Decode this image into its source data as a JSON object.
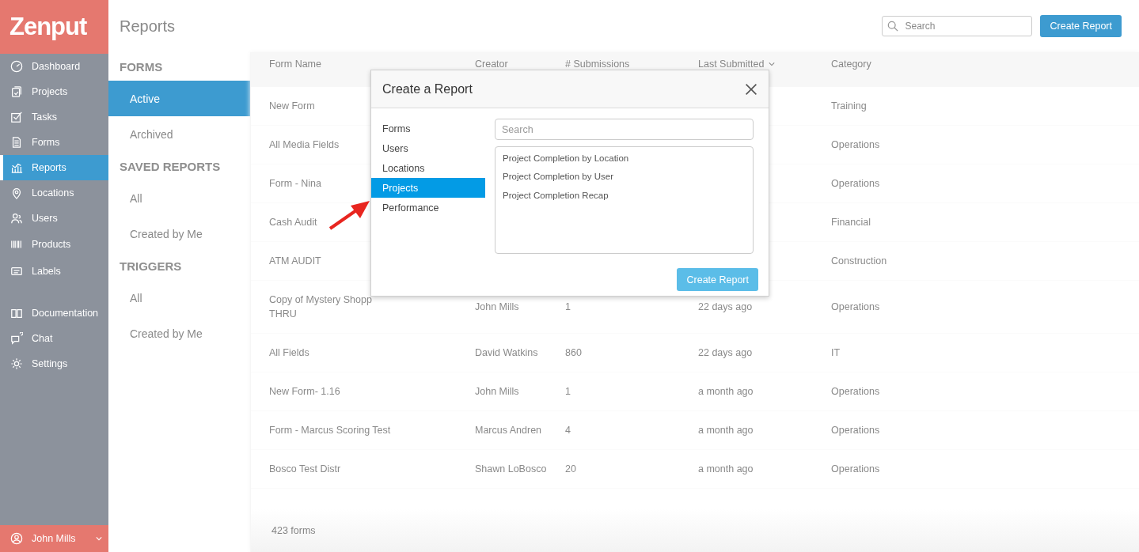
{
  "sidebar": {
    "logo": "Zenput",
    "items": [
      {
        "label": "Dashboard",
        "selected": false
      },
      {
        "label": "Projects",
        "selected": false
      },
      {
        "label": "Tasks",
        "selected": false
      },
      {
        "label": "Forms",
        "selected": false
      },
      {
        "label": "Reports",
        "selected": true
      },
      {
        "label": "Locations",
        "selected": false
      },
      {
        "label": "Users",
        "selected": false
      },
      {
        "label": "Products",
        "selected": false
      },
      {
        "label": "Labels",
        "selected": false
      }
    ],
    "help_items": [
      {
        "label": "Documentation"
      },
      {
        "label": "Chat"
      },
      {
        "label": "Settings"
      }
    ],
    "user": {
      "name": "John Mills"
    }
  },
  "header": {
    "title": "Reports",
    "search": {
      "placeholder": "Search"
    },
    "button": "Create Report"
  },
  "subnav": [
    {
      "heading": "FORMS",
      "items": [
        {
          "label": "Active",
          "selected": true
        },
        {
          "label": "Archived",
          "selected": false
        }
      ]
    },
    {
      "heading": "SAVED REPORTS",
      "items": [
        {
          "label": "All",
          "selected": false
        },
        {
          "label": "Created by Me",
          "selected": false
        }
      ]
    },
    {
      "heading": "TRIGGERS",
      "items": [
        {
          "label": "All",
          "selected": false
        },
        {
          "label": "Created by Me",
          "selected": false
        }
      ]
    }
  ],
  "table": {
    "columns": [
      {
        "label": "Form Name",
        "sorted": false
      },
      {
        "label": "Creator",
        "sorted": false
      },
      {
        "label": "# Submissions",
        "sorted": false
      },
      {
        "label": "Last Submitted",
        "sorted": true
      },
      {
        "label": "Category",
        "sorted": false
      }
    ],
    "rows": [
      {
        "name": [
          "New Form"
        ],
        "category": "Training"
      },
      {
        "name": [
          "All Media Fields"
        ],
        "category": "Operations"
      },
      {
        "name": [
          "Form - Nina"
        ],
        "category": "Operations"
      },
      {
        "name": [
          "Cash Audit"
        ],
        "category": "Financial"
      },
      {
        "name": [
          "ATM AUDIT"
        ],
        "category": "Construction"
      },
      {
        "name": [
          "Copy of Mystery Shopp",
          "THRU"
        ],
        "creator": "John Mills",
        "submissions": "1",
        "last_submitted": "22 days ago",
        "category": "Operations"
      },
      {
        "name": [
          "All Fields"
        ],
        "creator": "David Watkins",
        "submissions": "860",
        "last_submitted": "22 days ago",
        "category": "IT"
      },
      {
        "name": [
          "New Form- 1.16"
        ],
        "creator": "John Mills",
        "submissions": "1",
        "last_submitted": "a month ago",
        "category": "Operations"
      },
      {
        "name": [
          "Form - Marcus Scoring Test"
        ],
        "creator": "Marcus Andren",
        "submissions": "4",
        "last_submitted": "a month ago",
        "category": "Operations"
      },
      {
        "name": [
          "Bosco Test Distr"
        ],
        "creator": "Shawn LoBosco",
        "submissions": "20",
        "last_submitted": "a month ago",
        "category": "Operations"
      }
    ],
    "footer": "423 forms"
  },
  "modal": {
    "title": "Create a Report",
    "categories": [
      {
        "label": "Forms",
        "selected": false
      },
      {
        "label": "Users",
        "selected": false
      },
      {
        "label": "Locations",
        "selected": false
      },
      {
        "label": "Projects",
        "selected": true
      },
      {
        "label": "Performance",
        "selected": false
      }
    ],
    "search": {
      "placeholder": "Search"
    },
    "reports": [
      "Project Completion by Location",
      "Project Completion by User",
      "Project Completion Recap"
    ],
    "button": "Create Report"
  }
}
